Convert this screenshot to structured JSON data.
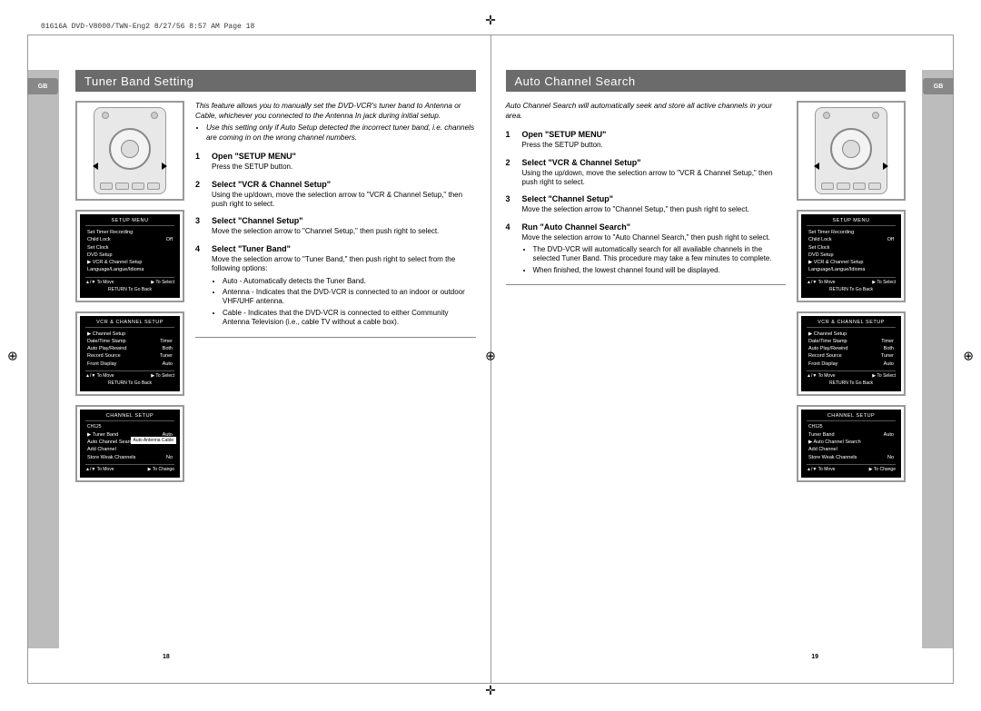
{
  "print_header": "01616A DVD-V8000/TWN-Eng2  8/27/56 8:57 AM  Page 18",
  "tab_label": "GB",
  "page_left_num": "18",
  "page_right_num": "19",
  "left": {
    "title": "Tuner Band Setting",
    "intro_main": "This feature allows you to manually set the DVD-VCR's tuner band to Antenna or Cable, whichever you connected to the Antenna In jack during initial setup.",
    "intro_bullet": "Use this setting only if Auto Setup detected the incorrect tuner band, i.e. channels are coming in on the wrong channel numbers.",
    "steps": [
      {
        "num": "1",
        "title": "Open \"SETUP MENU\"",
        "body": "Press the SETUP button."
      },
      {
        "num": "2",
        "title": "Select \"VCR & Channel Setup\"",
        "body": "Using the up/down, move the selection arrow to \"VCR & Channel Setup,\" then push right to select."
      },
      {
        "num": "3",
        "title": "Select \"Channel Setup\"",
        "body": "Move the selection arrow to \"Channel Setup,\" then push right to select."
      },
      {
        "num": "4",
        "title": "Select \"Tuner Band\"",
        "body": "Move the selection arrow to \"Tuner Band,\" then push right to select from the following options:",
        "bullets": [
          "Auto - Automatically detects the Tuner Band.",
          "Antenna - Indicates that the DVD-VCR is connected to an indoor or outdoor VHF/UHF antenna.",
          "Cable - Indicates that the DVD-VCR is connected to either Community Antenna Television (i.e., cable TV without a cable box)."
        ]
      }
    ],
    "osd1": {
      "title": "SETUP MENU",
      "rows": [
        {
          "l": "Set Timer Recording",
          "r": ""
        },
        {
          "l": "Child Lock",
          "r": "Off"
        },
        {
          "l": "Set Clock",
          "r": ""
        },
        {
          "l": "DVD Setup",
          "r": ""
        },
        {
          "l": "▶ VCR & Channel Setup",
          "r": ""
        },
        {
          "l": "Language/Langue/Idioma",
          "r": ""
        }
      ],
      "foot_l": "▲/▼ To Move",
      "foot_r": "▶ To Select",
      "ret": "RETURN To Go Back"
    },
    "osd2": {
      "title": "VCR & CHANNEL SETUP",
      "rows": [
        {
          "l": "▶ Channel Setup",
          "r": ""
        },
        {
          "l": "Date/Time Stamp",
          "r": "Timer"
        },
        {
          "l": "Auto Play/Rewind",
          "r": "Both"
        },
        {
          "l": "Record Source",
          "r": "Tuner"
        },
        {
          "l": "Front Display",
          "r": "Auto"
        }
      ],
      "foot_l": "▲/▼ To Move",
      "foot_r": "▶ To Select",
      "ret": "RETURN To Go Back"
    },
    "osd3": {
      "title": "CHANNEL SETUP",
      "sub": "CH125",
      "rows": [
        {
          "l": "▶ Tuner Band",
          "r": "Auto"
        },
        {
          "l": "Auto Channel Search",
          "r": ""
        },
        {
          "l": "Add Channel",
          "r": ""
        },
        {
          "l": "Store Weak Channels",
          "r": "No"
        }
      ],
      "card": "Auto\nAntenna\nCable",
      "foot_l": "▲/▼ To Move",
      "foot_r": "▶ To Change"
    }
  },
  "right": {
    "title": "Auto Channel Search",
    "intro_main": "Auto Channel Search will automatically seek and store all active channels in your area.",
    "steps": [
      {
        "num": "1",
        "title": "Open \"SETUP MENU\"",
        "body": "Press the SETUP button."
      },
      {
        "num": "2",
        "title": "Select \"VCR & Channel Setup\"",
        "body": "Using the up/down, move the selection arrow to \"VCR & Channel Setup,\" then push right to select."
      },
      {
        "num": "3",
        "title": "Select \"Channel Setup\"",
        "body": "Move the selection arrow to \"Channel Setup,\" then push right to select."
      },
      {
        "num": "4",
        "title": "Run \"Auto Channel Search\"",
        "body": "Move the selection arrow to \"Auto Channel Search,\" then push right to select.",
        "bullets": [
          "The DVD-VCR will automatically search for all available channels in the selected Tuner Band. This procedure may take a few minutes to complete.",
          "When finished, the lowest channel found will be displayed."
        ]
      }
    ],
    "osd1": {
      "title": "SETUP MENU",
      "rows": [
        {
          "l": "Set Timer Recording",
          "r": ""
        },
        {
          "l": "Child Lock",
          "r": "Off"
        },
        {
          "l": "Set Clock",
          "r": ""
        },
        {
          "l": "DVD Setup",
          "r": ""
        },
        {
          "l": "▶ VCR & Channel Setup",
          "r": ""
        },
        {
          "l": "Language/Langue/Idioma",
          "r": ""
        }
      ],
      "foot_l": "▲/▼ To Move",
      "foot_r": "▶ To Select",
      "ret": "RETURN To Go Back"
    },
    "osd2": {
      "title": "VCR & CHANNEL SETUP",
      "rows": [
        {
          "l": "▶ Channel Setup",
          "r": ""
        },
        {
          "l": "Date/Time Stamp",
          "r": "Timer"
        },
        {
          "l": "Auto Play/Rewind",
          "r": "Both"
        },
        {
          "l": "Record Source",
          "r": "Tuner"
        },
        {
          "l": "Front Display",
          "r": "Auto"
        }
      ],
      "foot_l": "▲/▼ To Move",
      "foot_r": "▶ To Select",
      "ret": "RETURN To Go Back"
    },
    "osd3": {
      "title": "CHANNEL SETUP",
      "sub": "CH125",
      "rows": [
        {
          "l": "Tuner Band",
          "r": "Auto"
        },
        {
          "l": "▶ Auto Channel Search",
          "r": ""
        },
        {
          "l": "Add Channel",
          "r": ""
        },
        {
          "l": "Store Weak Channels",
          "r": "No"
        }
      ],
      "foot_l": "▲/▼ To Move",
      "foot_r": "▶ To Change"
    }
  }
}
